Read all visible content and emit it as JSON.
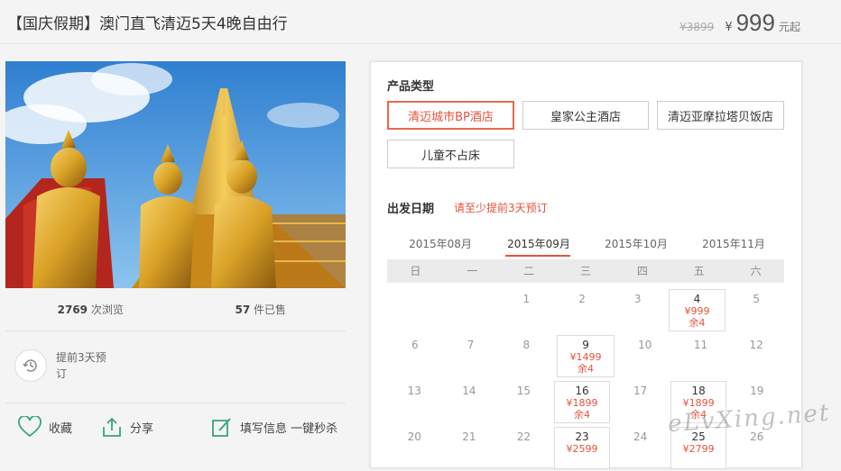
{
  "product": {
    "title": "【国庆假期】澳门直飞清迈5天4晚自由行",
    "old_price": "¥3899",
    "currency": "¥",
    "price": "999",
    "price_suffix": "元起"
  },
  "stats": {
    "views": "2769",
    "views_label": "次浏览",
    "sold": "57",
    "sold_label": "件已售"
  },
  "advance_note": "提前3天预订",
  "actions": {
    "favorite": "收藏",
    "share": "分享",
    "fill_info": "填写信息 一键秒杀"
  },
  "product_type": {
    "label": "产品类型",
    "options": [
      "清迈城市BP酒店",
      "皇家公主酒店",
      "清迈亚摩拉塔贝饭店",
      "儿童不占床"
    ],
    "selected": 0
  },
  "departure": {
    "label": "出发日期",
    "hint": "请至少提前3天预订",
    "months": [
      "2015年08月",
      "2015年09月",
      "2015年10月",
      "2015年11月"
    ],
    "active_month": 1,
    "weekdays": [
      "日",
      "一",
      "二",
      "三",
      "四",
      "五",
      "六"
    ],
    "weeks": [
      [
        {
          "d": ""
        },
        {
          "d": ""
        },
        {
          "d": "1"
        },
        {
          "d": "2"
        },
        {
          "d": "3"
        },
        {
          "d": "4",
          "price": "¥999",
          "stock": "余4"
        },
        {
          "d": "5"
        }
      ],
      [
        {
          "d": "6"
        },
        {
          "d": "7"
        },
        {
          "d": "8"
        },
        {
          "d": "9",
          "price": "¥1499",
          "stock": "余4"
        },
        {
          "d": "10"
        },
        {
          "d": "11"
        },
        {
          "d": "12"
        }
      ],
      [
        {
          "d": "13"
        },
        {
          "d": "14"
        },
        {
          "d": "15"
        },
        {
          "d": "16",
          "price": "¥1899",
          "stock": "余4"
        },
        {
          "d": "17"
        },
        {
          "d": "18",
          "price": "¥1899",
          "stock": "余4"
        },
        {
          "d": "19"
        }
      ],
      [
        {
          "d": "20"
        },
        {
          "d": "21"
        },
        {
          "d": "22"
        },
        {
          "d": "23",
          "price": "¥2599",
          "stock": ""
        },
        {
          "d": "24"
        },
        {
          "d": "25",
          "price": "¥2799",
          "stock": ""
        },
        {
          "d": "26"
        }
      ]
    ]
  },
  "watermark": "eLvXing.net",
  "colors": {
    "accent": "#e4533e",
    "background": "#f4f4f4"
  }
}
